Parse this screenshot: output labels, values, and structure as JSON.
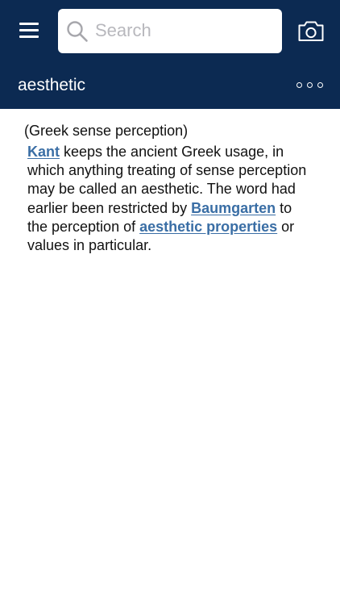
{
  "header": {
    "search_placeholder": "Search",
    "title": "aesthetic",
    "background_color": "#0c2a52",
    "icons": {
      "menu": "hamburger-menu-icon",
      "search": "magnifier-icon",
      "camera": "camera-icon",
      "more": "more-options-icon"
    }
  },
  "entry": {
    "sense": "(Greek sense perception)",
    "definition": {
      "link_kant": "Kant",
      "text_1": " keeps the ancient Greek usage, in which anything treating of sense perception may be called an aesthetic. The word had earlier been restricted by ",
      "link_baumgarten": "Baumgarten",
      "text_2": " to the perception of ",
      "link_aesthetic_properties": "aesthetic properties",
      "text_3": " or values in particular."
    },
    "link_color": "#3a6ea5"
  }
}
